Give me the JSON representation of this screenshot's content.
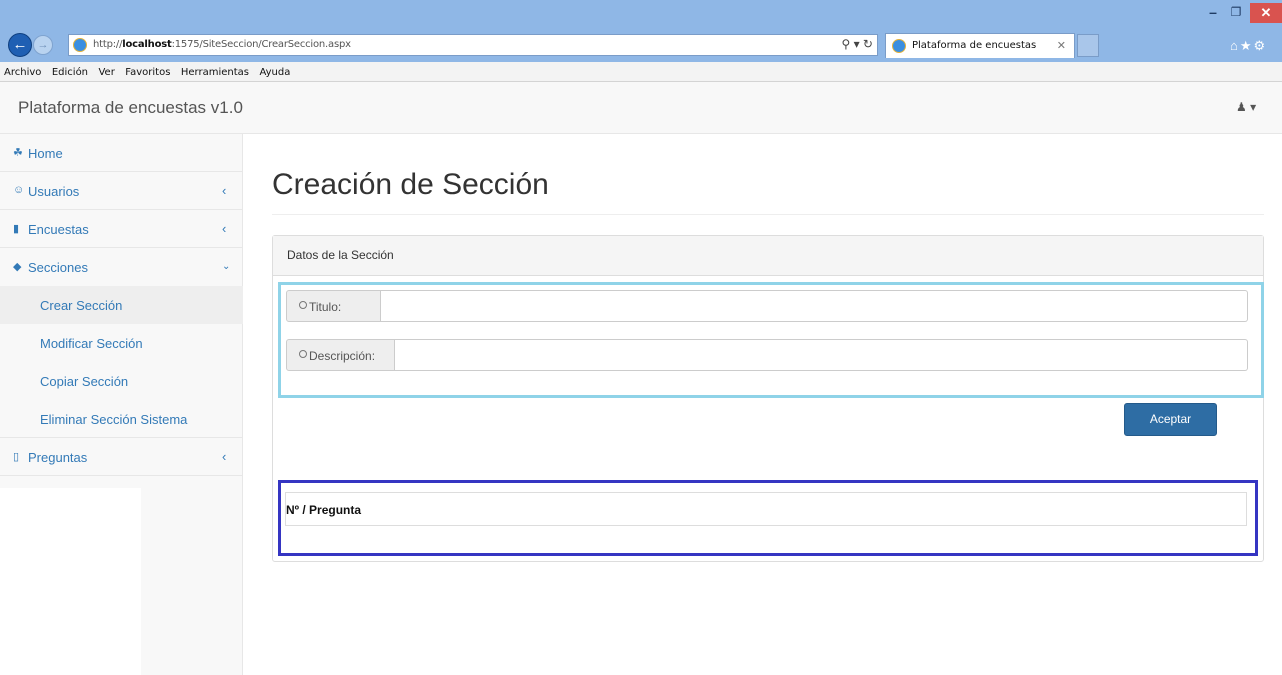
{
  "browser": {
    "url_prefix": "http://",
    "url_host": "localhost",
    "url_rest": ":1575/SiteSeccion/CrearSeccion.aspx",
    "tab_title": "Plataforma de encuestas",
    "menu": [
      "Archivo",
      "Edición",
      "Ver",
      "Favoritos",
      "Herramientas",
      "Ayuda"
    ]
  },
  "navbar": {
    "brand": "Plataforma de encuestas v1.0",
    "user_icon": "user-icon"
  },
  "sidebar": {
    "items": [
      {
        "icon": "home-icon",
        "label": "Home"
      },
      {
        "icon": "users-icon",
        "label": "Usuarios"
      },
      {
        "icon": "bookmark-icon",
        "label": "Encuestas"
      },
      {
        "icon": "tags-icon",
        "label": "Secciones"
      },
      {
        "icon": "bookmark-outline-icon",
        "label": "Preguntas"
      }
    ],
    "sub_items": [
      "Crear Sección",
      "Modificar Sección",
      "Copiar Sección",
      "Eliminar Sección Sistema"
    ]
  },
  "main": {
    "title": "Creación de Sección",
    "panel_title": "Datos de la Sección",
    "fields": [
      {
        "label": "Titulo:",
        "value": ""
      },
      {
        "label": "Descripción:",
        "value": ""
      }
    ],
    "submit_label": "Aceptar",
    "table_header": "Nº / Pregunta"
  },
  "colors": {
    "link": "#337ab7",
    "primary_button": "#2e6da4",
    "form_highlight": "#8fd3e8",
    "table_highlight": "#3535c2"
  }
}
